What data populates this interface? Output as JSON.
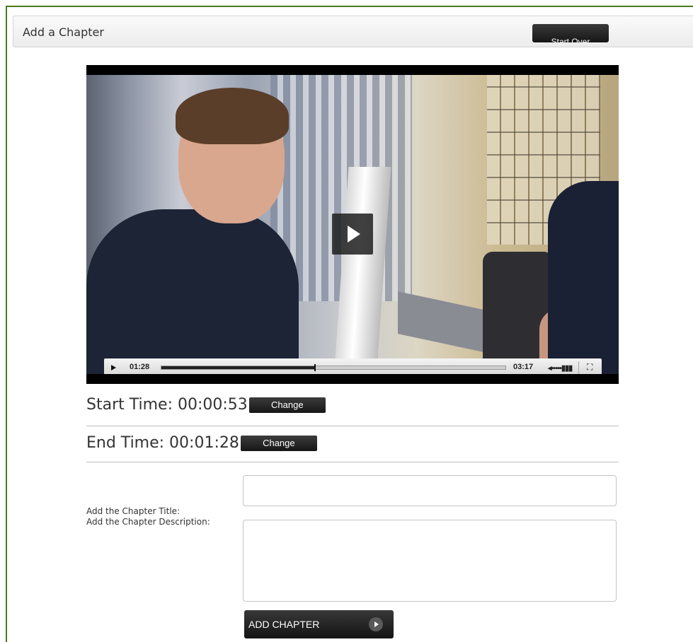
{
  "header": {
    "title": "Add a Chapter",
    "start_over_label": "Start Over"
  },
  "video": {
    "current_time": "01:28",
    "duration": "03:17",
    "progress_fraction": 0.4467,
    "volume_icon": "volume-icon",
    "fullscreen_icon": "fullscreen-icon",
    "volume_glyph": "◂▪▪▪▪▪▮▮▮",
    "fullscreen_glyph": "⛶"
  },
  "start_time": {
    "label": "Start Time: 00:00:53",
    "button": "Change"
  },
  "end_time": {
    "label": "End Time: 00:01:28",
    "button": "Change"
  },
  "form": {
    "title_label": "Add the Chapter Title:",
    "description_label": "Add the Chapter Description:",
    "title_value": "",
    "description_value": "",
    "submit_label": "ADD CHAPTER"
  },
  "colors": {
    "frame_border": "#4a7a1e",
    "button_dark": "#1a1a1a"
  }
}
